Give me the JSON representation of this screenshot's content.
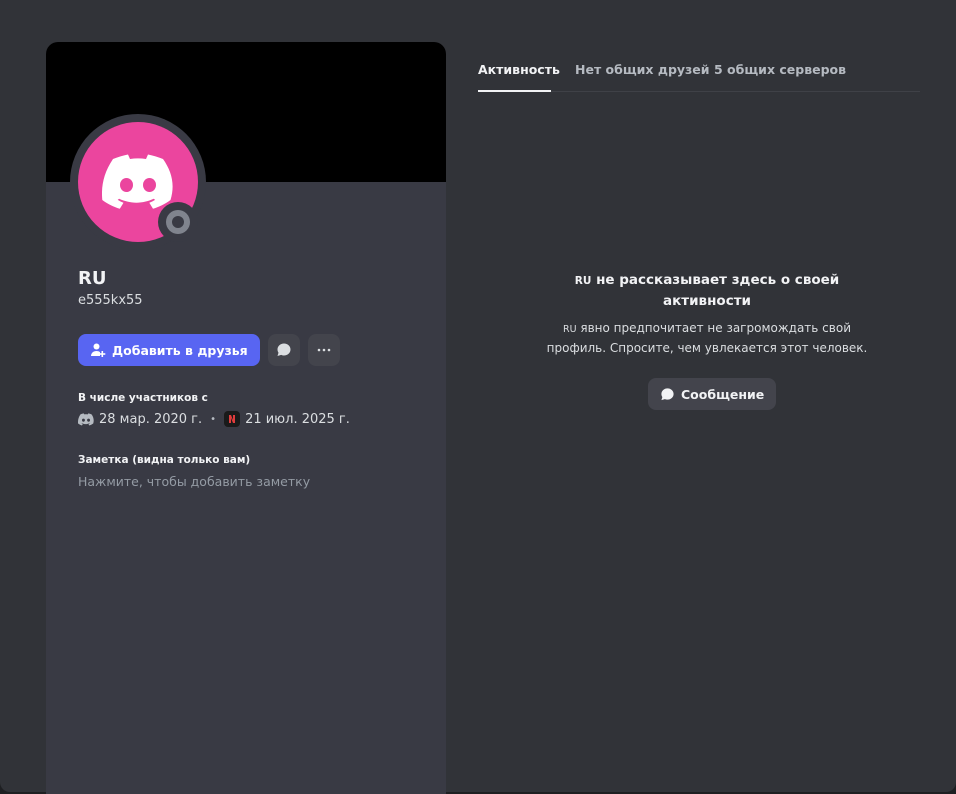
{
  "profile": {
    "display_name": "RU",
    "username": "e555kx55",
    "avatar_color": "#eb459e",
    "banner_color": "#000000",
    "status": "offline"
  },
  "actions": {
    "add_friend_label": "Добавить в друзья"
  },
  "member_since": {
    "title": "В числе участников с",
    "discord_date": "28 мар. 2020 г.",
    "server_date": "21 июл. 2025 г."
  },
  "note": {
    "title": "Заметка (видна только вам)",
    "placeholder": "Нажмите, чтобы добавить заметку"
  },
  "tabs": [
    {
      "label": "Активность",
      "active": true
    },
    {
      "label": "Нет общих друзей",
      "active": false
    },
    {
      "label": "5 общих серверов",
      "active": false
    }
  ],
  "empty_state": {
    "name": "RU",
    "title_rest": " не рассказывает здесь о своей",
    "title_line2": "активности",
    "text_name": "RU",
    "text_rest": " явно предпочитает не загромождать свой",
    "text_line2": "профиль. Спросите, чем увлекается этот человек.",
    "button_label": "Сообщение"
  },
  "colors": {
    "accent": "#5865f2",
    "status_offline": "#80848e"
  }
}
